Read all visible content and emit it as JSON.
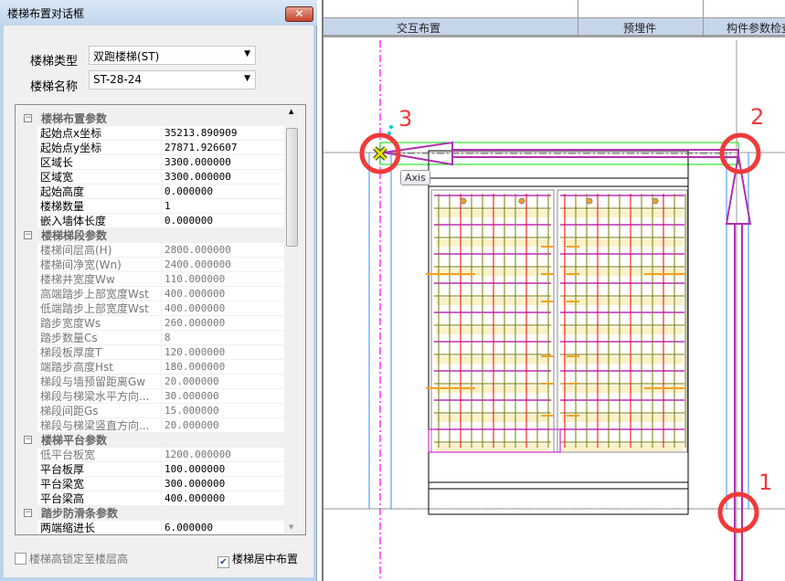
{
  "dialog": {
    "title": "楼梯布置对话框",
    "close_label": "✕",
    "stair_type_label": "楼梯类型",
    "stair_type_value": "双跑楼梯(ST)",
    "stair_name_label": "楼梯名称",
    "stair_name_value": "ST-28-24",
    "groups": [
      {
        "title": "楼梯布置参数",
        "rows": [
          {
            "key": "起始点x坐标",
            "value": "35213.890909",
            "dim": false
          },
          {
            "key": "起始点y坐标",
            "value": "27871.926607",
            "dim": false
          },
          {
            "key": "区域长",
            "value": "3300.000000",
            "dim": false
          },
          {
            "key": "区域宽",
            "value": "3300.000000",
            "dim": false
          },
          {
            "key": "起始高度",
            "value": "0.000000",
            "dim": false
          },
          {
            "key": "楼梯数量",
            "value": "1",
            "dim": false
          },
          {
            "key": "嵌入墙体长度",
            "value": "0.000000",
            "dim": false
          }
        ]
      },
      {
        "title": "楼梯梯段参数",
        "rows": [
          {
            "key": "楼梯间层高(H)",
            "value": "2800.000000",
            "dim": true
          },
          {
            "key": "楼梯间净宽(Wn)",
            "value": "2400.000000",
            "dim": true
          },
          {
            "key": "楼梯井宽度Ww",
            "value": "110.000000",
            "dim": true
          },
          {
            "key": "高端踏步上部宽度Wst",
            "value": "400.000000",
            "dim": true
          },
          {
            "key": "低端踏步上部宽度Wst",
            "value": "400.000000",
            "dim": true
          },
          {
            "key": "踏步宽度Ws",
            "value": "260.000000",
            "dim": true
          },
          {
            "key": "踏步数量Cs",
            "value": "8",
            "dim": true
          },
          {
            "key": "梯段板厚度T",
            "value": "120.000000",
            "dim": true
          },
          {
            "key": "端踏步高度Hst",
            "value": "180.000000",
            "dim": true
          },
          {
            "key": "梯段与墙预留距离Gw",
            "value": "20.000000",
            "dim": true
          },
          {
            "key": "梯段与梯梁水平方向...",
            "value": "30.000000",
            "dim": true
          },
          {
            "key": "梯段间距Gs",
            "value": "15.000000",
            "dim": true
          },
          {
            "key": "梯段与梯梁竖直方向...",
            "value": "20.000000",
            "dim": true
          }
        ]
      },
      {
        "title": "楼梯平台参数",
        "rows": [
          {
            "key": "低平台板宽",
            "value": "1200.000000",
            "dim": true
          },
          {
            "key": "平台板厚",
            "value": "100.000000",
            "dim": false
          },
          {
            "key": "平台梁宽",
            "value": "300.000000",
            "dim": false
          },
          {
            "key": "平台梁高",
            "value": "400.000000",
            "dim": false
          }
        ]
      },
      {
        "title": "踏步防滑条参数",
        "rows": [
          {
            "key": "两端缩进长",
            "value": "6.000000",
            "dim": false
          }
        ]
      }
    ],
    "lock_height_label": "楼梯高锁定至楼层高",
    "lock_height_checked": false,
    "center_label": "楼梯居中布置",
    "center_checked": true
  },
  "toolbar": {
    "tabs": [
      "交互布置",
      "预埋件",
      "构件参数检查"
    ]
  },
  "canvas": {
    "tooltip": "Axis",
    "markers": [
      "3",
      "2",
      "1"
    ],
    "colors": {
      "marker": "#f03a3a",
      "axis": "#ff00ff",
      "arrow": "#b030b0",
      "boundary": "#00e000",
      "wall": "#3a8ee8"
    }
  }
}
